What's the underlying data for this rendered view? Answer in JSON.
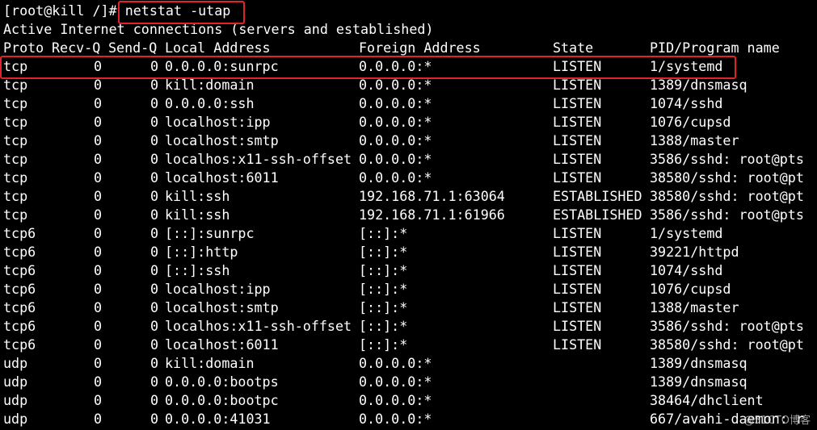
{
  "prompt": {
    "text": "[root@kill /]# ",
    "command": "netstat -utap"
  },
  "title_line": "Active Internet connections (servers and established)",
  "headers": {
    "proto": "Proto",
    "recvq": "Recv-Q",
    "sendq": "Send-Q",
    "local": "Local Address",
    "foreign": "Foreign Address",
    "state": "State",
    "pid": "PID/Program name"
  },
  "rows": [
    {
      "proto": "tcp",
      "recvq": "0",
      "sendq": "0",
      "local": "0.0.0.0:sunrpc",
      "foreign": "0.0.0.0:*",
      "state": "LISTEN",
      "pid": "1/systemd"
    },
    {
      "proto": "tcp",
      "recvq": "0",
      "sendq": "0",
      "local": "kill:domain",
      "foreign": "0.0.0.0:*",
      "state": "LISTEN",
      "pid": "1389/dnsmasq"
    },
    {
      "proto": "tcp",
      "recvq": "0",
      "sendq": "0",
      "local": "0.0.0.0:ssh",
      "foreign": "0.0.0.0:*",
      "state": "LISTEN",
      "pid": "1074/sshd"
    },
    {
      "proto": "tcp",
      "recvq": "0",
      "sendq": "0",
      "local": "localhost:ipp",
      "foreign": "0.0.0.0:*",
      "state": "LISTEN",
      "pid": "1076/cupsd"
    },
    {
      "proto": "tcp",
      "recvq": "0",
      "sendq": "0",
      "local": "localhost:smtp",
      "foreign": "0.0.0.0:*",
      "state": "LISTEN",
      "pid": "1388/master"
    },
    {
      "proto": "tcp",
      "recvq": "0",
      "sendq": "0",
      "local": "localhos:x11-ssh-offset",
      "foreign": "0.0.0.0:*",
      "state": "LISTEN",
      "pid": "3586/sshd: root@pts"
    },
    {
      "proto": "tcp",
      "recvq": "0",
      "sendq": "0",
      "local": "localhost:6011",
      "foreign": "0.0.0.0:*",
      "state": "LISTEN",
      "pid": "38580/sshd: root@pt"
    },
    {
      "proto": "tcp",
      "recvq": "0",
      "sendq": "0",
      "local": "kill:ssh",
      "foreign": "192.168.71.1:63064",
      "state": "ESTABLISHED",
      "pid": "38580/sshd: root@pt"
    },
    {
      "proto": "tcp",
      "recvq": "0",
      "sendq": "0",
      "local": "kill:ssh",
      "foreign": "192.168.71.1:61966",
      "state": "ESTABLISHED",
      "pid": "3586/sshd: root@pts"
    },
    {
      "proto": "tcp6",
      "recvq": "0",
      "sendq": "0",
      "local": "[::]:sunrpc",
      "foreign": "[::]:*",
      "state": "LISTEN",
      "pid": "1/systemd"
    },
    {
      "proto": "tcp6",
      "recvq": "0",
      "sendq": "0",
      "local": "[::]:http",
      "foreign": "[::]:*",
      "state": "LISTEN",
      "pid": "39221/httpd"
    },
    {
      "proto": "tcp6",
      "recvq": "0",
      "sendq": "0",
      "local": "[::]:ssh",
      "foreign": "[::]:*",
      "state": "LISTEN",
      "pid": "1074/sshd"
    },
    {
      "proto": "tcp6",
      "recvq": "0",
      "sendq": "0",
      "local": "localhost:ipp",
      "foreign": "[::]:*",
      "state": "LISTEN",
      "pid": "1076/cupsd"
    },
    {
      "proto": "tcp6",
      "recvq": "0",
      "sendq": "0",
      "local": "localhost:smtp",
      "foreign": "[::]:*",
      "state": "LISTEN",
      "pid": "1388/master"
    },
    {
      "proto": "tcp6",
      "recvq": "0",
      "sendq": "0",
      "local": "localhos:x11-ssh-offset",
      "foreign": "[::]:*",
      "state": "LISTEN",
      "pid": "3586/sshd: root@pts"
    },
    {
      "proto": "tcp6",
      "recvq": "0",
      "sendq": "0",
      "local": "localhost:6011",
      "foreign": "[::]:*",
      "state": "LISTEN",
      "pid": "38580/sshd: root@pt"
    },
    {
      "proto": "udp",
      "recvq": "0",
      "sendq": "0",
      "local": "kill:domain",
      "foreign": "0.0.0.0:*",
      "state": "",
      "pid": "1389/dnsmasq"
    },
    {
      "proto": "udp",
      "recvq": "0",
      "sendq": "0",
      "local": "0.0.0.0:bootps",
      "foreign": "0.0.0.0:*",
      "state": "",
      "pid": "1389/dnsmasq"
    },
    {
      "proto": "udp",
      "recvq": "0",
      "sendq": "0",
      "local": "0.0.0.0:bootpc",
      "foreign": "0.0.0.0:*",
      "state": "",
      "pid": "38464/dhclient"
    },
    {
      "proto": "udp",
      "recvq": "0",
      "sendq": "0",
      "local": "0.0.0.0:41031",
      "foreign": "0.0.0.0:*",
      "state": "",
      "pid": "667/avahi-daemon: r"
    }
  ],
  "watermark": "@51CTO博客",
  "colors": {
    "background": "#000000",
    "text": "#ffffff",
    "highlight": "#e0242c"
  }
}
